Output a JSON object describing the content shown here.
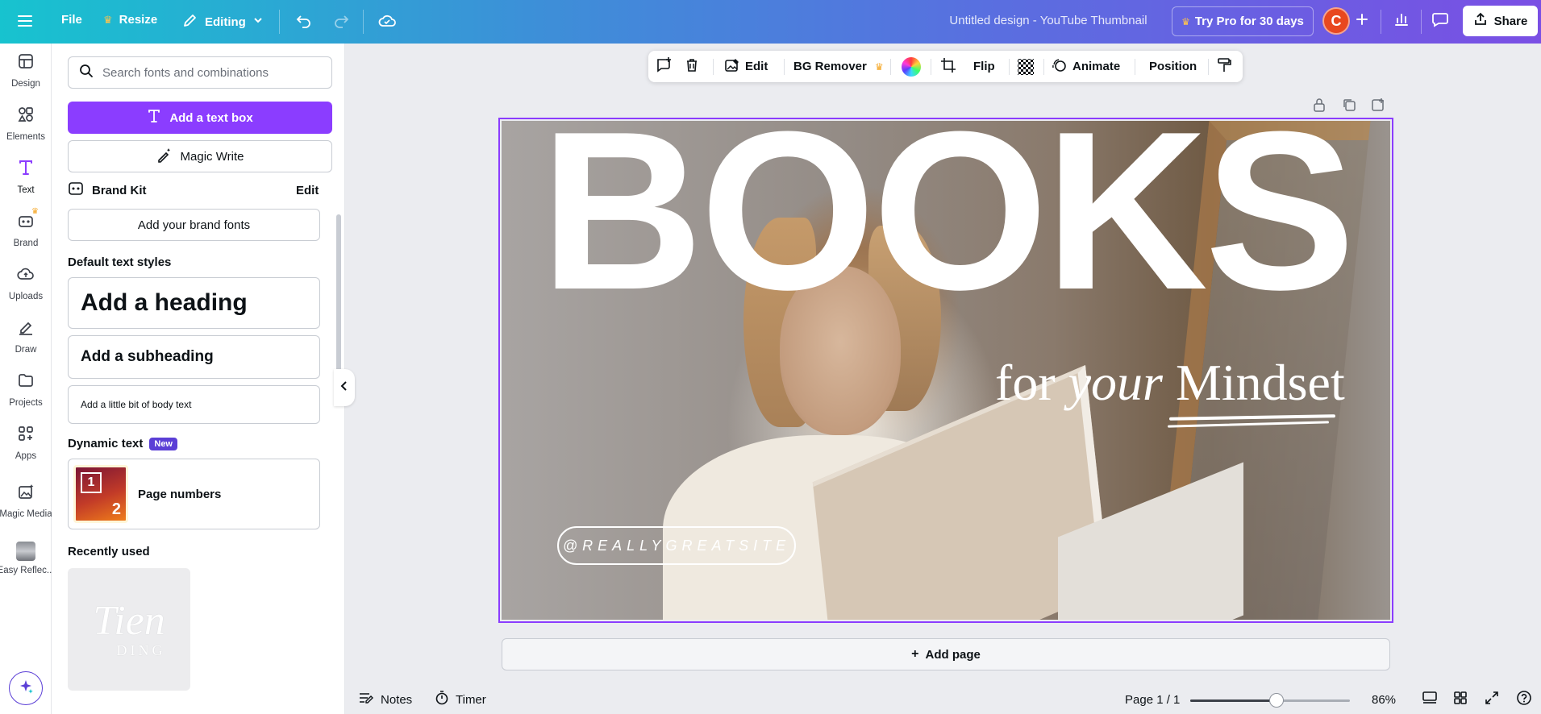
{
  "topbar": {
    "file_label": "File",
    "resize_label": "Resize",
    "editing_label": "Editing",
    "doc_title": "Untitled design - YouTube Thumbnail",
    "try_pro_label": "Try Pro for 30 days",
    "avatar_initial": "C",
    "share_label": "Share",
    "gradient_start": "#17c3cf",
    "gradient_end": "#7a4fe4"
  },
  "rail": {
    "items": [
      {
        "label": "Design",
        "icon": "design-icon"
      },
      {
        "label": "Elements",
        "icon": "elements-icon"
      },
      {
        "label": "Text",
        "icon": "text-icon"
      },
      {
        "label": "Brand",
        "icon": "brand-icon"
      },
      {
        "label": "Uploads",
        "icon": "uploads-icon"
      },
      {
        "label": "Draw",
        "icon": "draw-icon"
      },
      {
        "label": "Projects",
        "icon": "projects-icon"
      },
      {
        "label": "Apps",
        "icon": "apps-icon"
      },
      {
        "label": "Magic Media",
        "icon": "magic-media-icon"
      },
      {
        "label": "Easy Reflec...",
        "icon": "easy-reflection-icon"
      }
    ]
  },
  "panel": {
    "search_placeholder": "Search fonts and combinations",
    "add_text_box": "Add a text box",
    "magic_write": "Magic Write",
    "brand_kit": "Brand Kit",
    "brand_edit": "Edit",
    "add_brand_fonts": "Add your brand fonts",
    "default_styles_title": "Default text styles",
    "heading": "Add a heading",
    "subheading": "Add a subheading",
    "body": "Add a little bit of body text",
    "dynamic_text_title": "Dynamic text",
    "new_badge": "New",
    "page_numbers": "Page numbers",
    "page_numbers_digits": [
      "1",
      "2"
    ],
    "recently_used_title": "Recently used",
    "recent_font_preview": [
      "Tien",
      "DING"
    ],
    "accent": "#8b3dff"
  },
  "context_toolbar": {
    "edit": "Edit",
    "bg_remover": "BG Remover",
    "flip": "Flip",
    "animate": "Animate",
    "position": "Position"
  },
  "canvas": {
    "headline": "BOOKS",
    "tagline_for": "for",
    "tagline_your": "your",
    "tagline_mindset": "Mindset",
    "handle": "@REALLYGREATSITE"
  },
  "add_page_label": "Add page",
  "bottom": {
    "notes": "Notes",
    "timer": "Timer",
    "page_indicator": "Page 1 / 1",
    "zoom_label": "86%",
    "zoom_fraction": 0.54
  }
}
